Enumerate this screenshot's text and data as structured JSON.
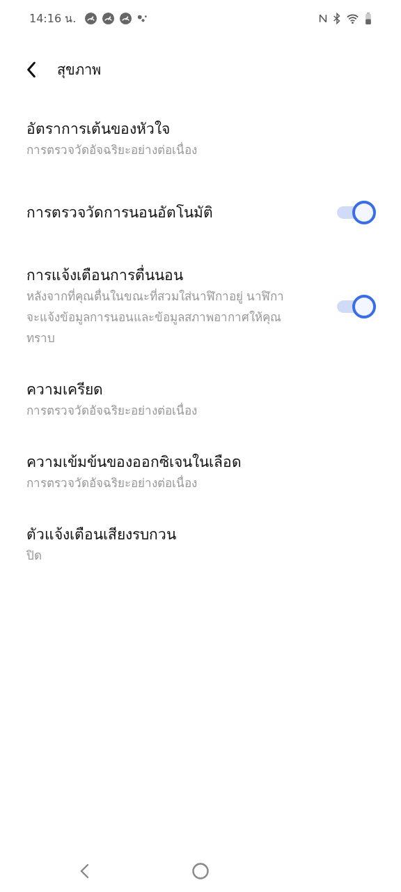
{
  "status_bar": {
    "time": "14:16 น."
  },
  "header": {
    "title": "สุขภาพ"
  },
  "items": [
    {
      "kind": "nav",
      "title": "อัตราการเต้นของหัวใจ",
      "subtitle": "การตรวจวัดอัจฉริยะอย่างต่อเนื่อง"
    },
    {
      "kind": "toggle",
      "title": "การตรวจวัดการนอนอัตโนมัติ",
      "on": true
    },
    {
      "kind": "toggle",
      "title": "การแจ้งเตือนการตื่นนอน",
      "subtitle": "หลังจากที่คุณตื่นในขณะที่สวมใส่นาฬิกาอยู่ นาฬิกาจะแจ้งข้อมูลการนอนและข้อมูลสภาพอากาศให้คุณทราบ",
      "on": true
    },
    {
      "kind": "nav",
      "title": "ความเครียด",
      "subtitle": "การตรวจวัดอัจฉริยะอย่างต่อเนื่อง"
    },
    {
      "kind": "nav",
      "title": "ความเข้มข้นของออกซิเจนในเลือด",
      "subtitle": "การตรวจวัดอัจฉริยะอย่างต่อเนื่อง"
    },
    {
      "kind": "nav",
      "title": "ตัวแจ้งเตือนเสียงรบกวน",
      "subtitle": "ปิด"
    }
  ]
}
